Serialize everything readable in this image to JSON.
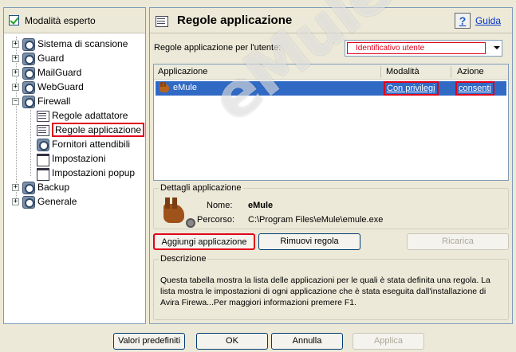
{
  "left_panel": {
    "expert_mode_label": "Modalità esperto",
    "tree": [
      {
        "label": "Sistema di scansione",
        "expander": "+"
      },
      {
        "label": "Guard",
        "expander": "+"
      },
      {
        "label": "MailGuard",
        "expander": "+"
      },
      {
        "label": "WebGuard",
        "expander": "+"
      },
      {
        "label": "Firewall",
        "expander": "−"
      },
      {
        "label": "Regole adattatore"
      },
      {
        "label": "Regole applicazione"
      },
      {
        "label": "Fornitori attendibili"
      },
      {
        "label": "Impostazioni"
      },
      {
        "label": "Impostazioni popup"
      },
      {
        "label": "Backup",
        "expander": "+"
      },
      {
        "label": "Generale",
        "expander": "+"
      }
    ]
  },
  "header": {
    "title": "Regole applicazione",
    "help_label": "Guida",
    "help_icon_glyph": "?"
  },
  "user_rules": {
    "label": "Regole applicazione per l'utente:",
    "selected_value": "Identificativo utente"
  },
  "table": {
    "columns": [
      "Applicazione",
      "Modalità",
      "Azione"
    ],
    "rows": [
      {
        "application": "eMule",
        "mode": "Con privilegi",
        "action": "consenti"
      }
    ]
  },
  "details": {
    "legend": "Dettagli applicazione",
    "name_label": "Nome:",
    "name_value": "eMule",
    "path_label": "Percorso:",
    "path_value": "C:\\Program Files\\eMule\\emule.exe"
  },
  "actions": {
    "add": "Aggiungi applicazione",
    "remove": "Rimuovi regola",
    "reload": "Ricarica"
  },
  "description": {
    "legend": "Descrizione",
    "text": "Questa tabella mostra la lista delle applicazioni per le quali è stata definita una regola. La lista mostra le impostazioni di ogni applicazione che è stata eseguita dall'installazione di Avira Firewa...Per maggiori informazioni premere F1."
  },
  "footer": {
    "defaults": "Valori predefiniti",
    "ok": "OK",
    "cancel": "Annulla",
    "apply": "Applica"
  },
  "watermark": "eMule.it",
  "colors": {
    "highlight": "#e0001a",
    "selection": "#316ac5",
    "link": "#0033cc"
  }
}
